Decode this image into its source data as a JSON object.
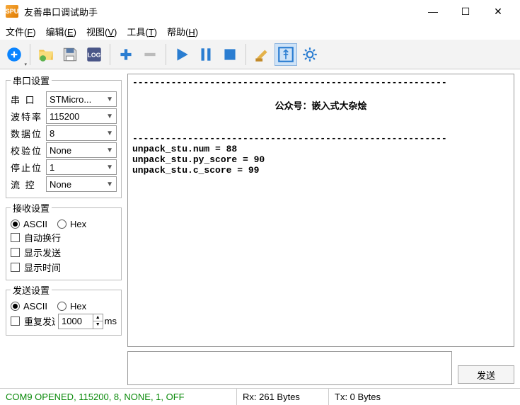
{
  "window": {
    "icon_text": "SPU",
    "title": "友善串口调试助手",
    "min": "—",
    "max": "☐",
    "close": "✕"
  },
  "menubar": {
    "file": "文件(F)",
    "edit": "编辑(E)",
    "view": "视图(V)",
    "tools": "工具(T)",
    "help": "帮助(H)"
  },
  "port_settings": {
    "legend": "串口设置",
    "port_lbl": "串 口",
    "port_val": "STMicro...",
    "baud_lbl": "波特率",
    "baud_val": "115200",
    "databits_lbl": "数据位",
    "databits_val": "8",
    "parity_lbl": "校验位",
    "parity_val": "None",
    "stopbits_lbl": "停止位",
    "stopbits_val": "1",
    "flow_lbl": "流 控",
    "flow_val": "None"
  },
  "recv_settings": {
    "legend": "接收设置",
    "ascii": "ASCII",
    "hex": "Hex",
    "autowrap": "自动换行",
    "showtx": "显示发送",
    "showtime": "显示时间"
  },
  "send_settings": {
    "legend": "发送设置",
    "ascii": "ASCII",
    "hex": "Hex",
    "repeat": "重复发送",
    "interval": "1000",
    "ms": "ms"
  },
  "output": {
    "hr": "---------------------------------------------------------",
    "banner": "公众号：嵌入式大杂烩",
    "l1": "unpack_stu.num = 88",
    "l2": "unpack_stu.py_score = 90",
    "l3": "unpack_stu.c_score = 99"
  },
  "send_btn": "发送",
  "status": {
    "conn": "COM9 OPENED, 115200, 8, NONE, 1, OFF",
    "rx": "Rx: 261 Bytes",
    "tx": "Tx: 0 Bytes"
  }
}
